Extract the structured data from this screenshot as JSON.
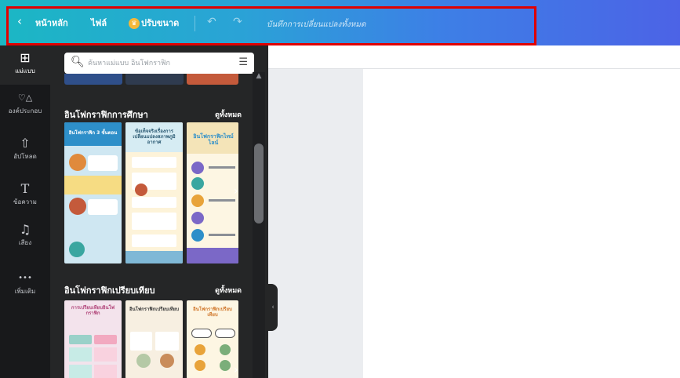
{
  "topbar": {
    "back_label": "‹",
    "home_label": "หน้าหลัก",
    "file_label": "ไฟล์",
    "resize_label": "ปรับขนาด",
    "undo_icon": "↶",
    "redo_icon": "↷",
    "save_status": "บันทึกการเปลี่ยนแปลงทั้งหมด",
    "gradient_start": "#1bb7c4",
    "gradient_end": "#4c63e6"
  },
  "sidebar": {
    "items": [
      {
        "icon": "⊞",
        "label": "แม่แบบ",
        "active": true
      },
      {
        "icon": "♡△",
        "label": "องค์ประกอบ"
      },
      {
        "icon": "⇧",
        "label": "อัปโหลด"
      },
      {
        "icon": "T",
        "label": "ข้อความ"
      },
      {
        "icon": "♫",
        "label": "เสียง"
      },
      {
        "icon": "•••",
        "label": "เพิ่มเติม"
      }
    ]
  },
  "search": {
    "placeholder": "ค้นหาแม่แบบ อินโฟกราฟิก"
  },
  "sections": [
    {
      "title": "อินโฟกราฟิกการศึกษา",
      "see_all": "ดูทั้งหมด",
      "thumbnails": [
        {
          "title": "อินโฟกราฟิก 3 ขั้นตอน"
        },
        {
          "title": "ข้อเท็จจริงเรื่องการเปลี่ยนแปลงสภาพภูมิอากาศ"
        },
        {
          "title": "อินโฟกราฟิกไทม์ไลน์"
        }
      ]
    },
    {
      "title": "อินโฟกราฟิกเปรียบเทียบ",
      "see_all": "ดูทั้งหมด",
      "thumbnails": [
        {
          "title": "การเปรียบเทียบอินโฟกราฟิก"
        },
        {
          "title": "อินโฟกราฟิกเปรียบเทียบ"
        },
        {
          "title": "อินโฟกราฟิกเปรียบเทียบ"
        }
      ]
    }
  ]
}
